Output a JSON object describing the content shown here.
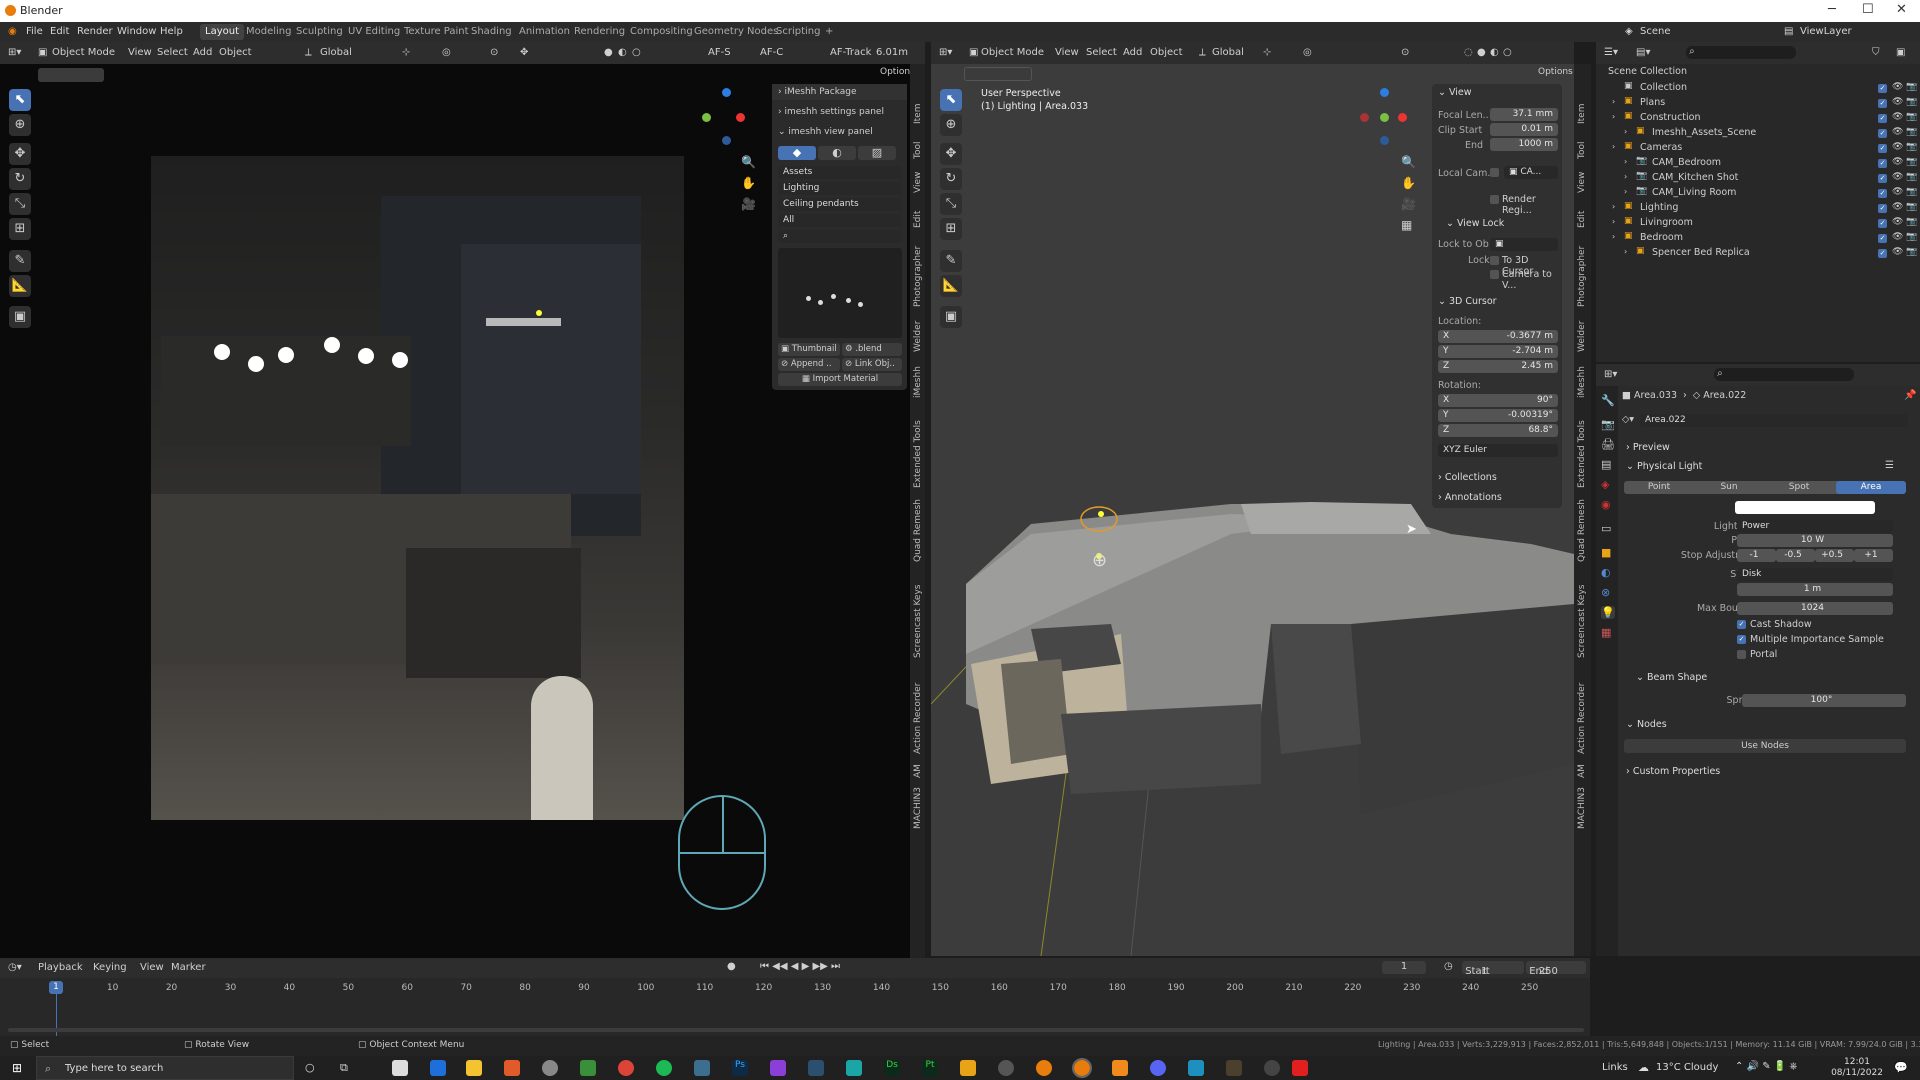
{
  "window": {
    "title": "Blender"
  },
  "menu": {
    "items": [
      "File",
      "Edit",
      "Render",
      "Window",
      "Help"
    ],
    "workspaces": [
      "Layout",
      "Modeling",
      "Sculpting",
      "UV Editing",
      "Texture Paint",
      "Shading",
      "Animation",
      "Rendering",
      "Compositing",
      "Geometry Nodes",
      "Scripting",
      "+"
    ],
    "active_workspace": "Layout"
  },
  "scene": {
    "label": "Scene",
    "view_layer": "ViewLayer"
  },
  "left_view": {
    "mode": "Object Mode",
    "menus": [
      "View",
      "Select",
      "Add",
      "Object"
    ],
    "orientation": "Global",
    "af_s": "AF-S",
    "af_c": "AF-C",
    "af_track": "AF-Track",
    "focal": "6.01m",
    "options": "Options"
  },
  "imeshh": {
    "package": "iMeshh Package",
    "settings": "imeshh settings panel",
    "view": "imeshh view panel",
    "assets": "Assets",
    "lighting": "Lighting",
    "ceiling": "Ceiling pendants",
    "all": "All",
    "thumbnail": "Thumbnail",
    "blend": ".blend",
    "append": "Append ..",
    "link": "Link Obj..",
    "import": "Import Material"
  },
  "right_view": {
    "mode": "Object Mode",
    "menus": [
      "View",
      "Select",
      "Add",
      "Object"
    ],
    "orientation": "Global",
    "persp": "User Perspective",
    "obj": "(1) Lighting | Area.033",
    "options": "Options"
  },
  "npanel": {
    "view": "View",
    "focal_label": "Focal Len..",
    "focal": "37.1 mm",
    "clip_start_label": "Clip Start",
    "clip_start": "0.01 m",
    "end_label": "End",
    "end": "1000 m",
    "local_cam": "Local Cam...",
    "render_region": "Render Regi...",
    "view_lock": "View Lock",
    "lock_to_obj": "Lock to Ob",
    "lock": "Lock",
    "to_cursor": "To 3D Cursor",
    "camera_to_view": "Camera to V...",
    "cursor": "3D Cursor",
    "location": "Location:",
    "loc_x": "-0.3677 m",
    "loc_y": "-2.704 m",
    "loc_z": "2.45 m",
    "rotation": "Rotation:",
    "rot_x": "90°",
    "rot_y": "-0.00319°",
    "rot_z": "68.8°",
    "euler": "XYZ Euler",
    "collections": "Collections",
    "annotations": "Annotations"
  },
  "outliner": {
    "root": "Scene Collection",
    "items": [
      "Collection",
      "Plans",
      "Construction",
      "Imeshh_Assets_Scene",
      "Cameras",
      "CAM_Bedroom",
      "CAM_Kitchen Shot",
      "CAM_Living Room",
      "Lighting",
      "Livingroom",
      "Bedroom",
      "Spencer Bed Replica"
    ]
  },
  "properties": {
    "breadcrumb_a": "Area.033",
    "breadcrumb_b": "Area.022",
    "data_name": "Area.022",
    "preview": "Preview",
    "physical_light": "Physical Light",
    "types": [
      "Point",
      "Sun",
      "Spot",
      "Area"
    ],
    "active_type": "Area",
    "color": "Color",
    "light_unit": "Light Unit",
    "light_unit_val": "Power",
    "power": "Power",
    "power_val": "10 W",
    "stop": "Stop Adjustment",
    "stops": [
      "-1",
      "-0.5",
      "+0.5",
      "+1"
    ],
    "shape": "Shape",
    "shape_val": "Disk",
    "size": "Size",
    "size_val": "1 m",
    "max_bounces": "Max Bounces",
    "max_bounces_val": "1024",
    "cast_shadow": "Cast Shadow",
    "mis": "Multiple Importance Sample",
    "portal": "Portal",
    "beam": "Beam Shape",
    "spread": "Spread",
    "spread_val": "100°",
    "nodes": "Nodes",
    "use_nodes": "Use Nodes",
    "custom": "Custom Properties"
  },
  "timeline": {
    "menus": [
      "Playback",
      "Keying",
      "View",
      "Marker"
    ],
    "current": "1",
    "start_label": "Start",
    "start": "1",
    "end_label": "End",
    "end": "250",
    "ticks": [
      "10",
      "20",
      "30",
      "40",
      "50",
      "60",
      "70",
      "80",
      "90",
      "100",
      "110",
      "120",
      "130",
      "140",
      "150",
      "160",
      "170",
      "180",
      "190",
      "200",
      "210",
      "220",
      "230",
      "240",
      "250"
    ],
    "marker": "1"
  },
  "status": {
    "select": "Select",
    "rotate": "Rotate View",
    "context": "Object Context Menu",
    "stats": "Lighting | Area.033 | Verts:3,229,913 | Faces:2,852,011 | Tris:5,649,848 | Objects:1/151 | Memory: 11.14 GiB | VRAM: 7.99/24.0 GiB | 3.3"
  },
  "taskbar": {
    "search": "Type here to search",
    "links": "Links",
    "weather": "13°C  Cloudy",
    "time": "12:01",
    "date": "08/11/2022"
  },
  "vtabs_left": [
    "Item",
    "Tool",
    "View",
    "Edit",
    "Photographer",
    "Welder",
    "iMeshh",
    "Extended Tools",
    "Quad Remesh",
    "Screencast Keys",
    "Action Recorder",
    "AM",
    "MACHIN3"
  ],
  "vtabs_right": [
    "Item",
    "Tool",
    "View",
    "Edit",
    "Photographer",
    "Welder",
    "iMeshh",
    "Extended Tools",
    "Quad Remesh",
    "Screencast Keys",
    "Action Recorder",
    "AM",
    "MACHIN3"
  ]
}
